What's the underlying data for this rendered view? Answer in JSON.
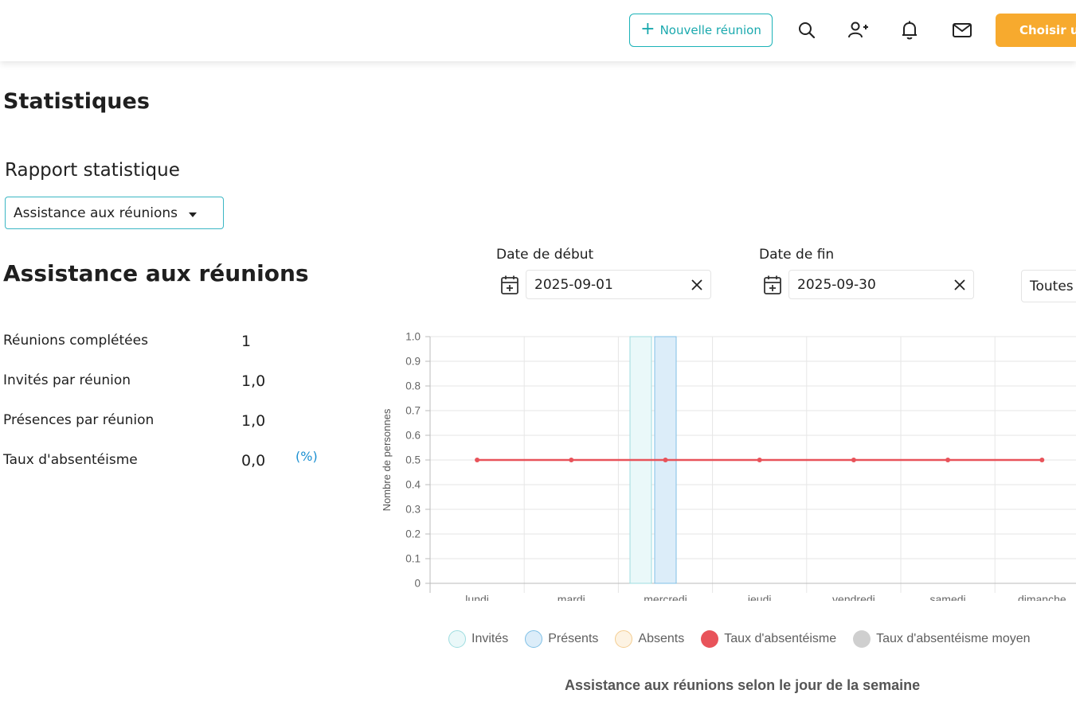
{
  "header": {
    "new_meeting_label": "Nouvelle réunion",
    "choose_label": "Choisir un",
    "accent_color": "#1bb3b8",
    "choose_color": "#f7aa2e",
    "icons": [
      "plus-icon",
      "search-icon",
      "add-user-icon",
      "bell-icon",
      "mail-icon"
    ]
  },
  "page": {
    "title": "Statistiques"
  },
  "report": {
    "label": "Rapport statistique",
    "selected": "Assistance aux réunions"
  },
  "section": {
    "title": "Assistance aux réunions"
  },
  "stats": [
    {
      "label": "Réunions complétées",
      "value": "1"
    },
    {
      "label": "Invités par réunion",
      "value": "1,0"
    },
    {
      "label": "Présences par réunion",
      "value": "1,0"
    },
    {
      "label": "Taux d'absentéisme",
      "value": "0,0",
      "unit": "(%)"
    }
  ],
  "filters": {
    "start_label": "Date de début",
    "start_value": "2025-09-01",
    "end_label": "Date de fin",
    "end_value": "2025-09-30",
    "group_value": "Toutes"
  },
  "chart_data": {
    "type": "bar",
    "title": "Assistance aux réunions selon le jour de la semaine",
    "ylabel": "Nombre de personnes",
    "xlabel": "",
    "categories": [
      "lundi",
      "mardi",
      "mercredi",
      "jeudi",
      "vendredi",
      "samedi",
      "dimanche"
    ],
    "ylim": [
      0,
      1.0
    ],
    "yticks": [
      "0",
      "0.1",
      "0.2",
      "0.3",
      "0.4",
      "0.5",
      "0.6",
      "0.7",
      "0.8",
      "0.9",
      "1.0"
    ],
    "grid": true,
    "legend_position": "bottom",
    "series": [
      {
        "name": "Invités",
        "type": "bar",
        "values": [
          0,
          0,
          1,
          0,
          0,
          0,
          0
        ],
        "color": "#b9e8ea"
      },
      {
        "name": "Présents",
        "type": "bar",
        "values": [
          0,
          0,
          1,
          0,
          0,
          0,
          0
        ],
        "color": "#a9d7f3"
      },
      {
        "name": "Absents",
        "type": "bar",
        "values": [
          0,
          0,
          0,
          0,
          0,
          0,
          0
        ],
        "color": "#fbe3bf"
      },
      {
        "name": "Taux d'absentéisme",
        "type": "line",
        "values": [
          0.5,
          0.5,
          0.5,
          0.5,
          0.5,
          0.5,
          0.5
        ],
        "color": "#e8535a"
      },
      {
        "name": "Taux d'absentéisme moyen",
        "type": "line",
        "values": [],
        "color": "#cccccc"
      }
    ]
  }
}
